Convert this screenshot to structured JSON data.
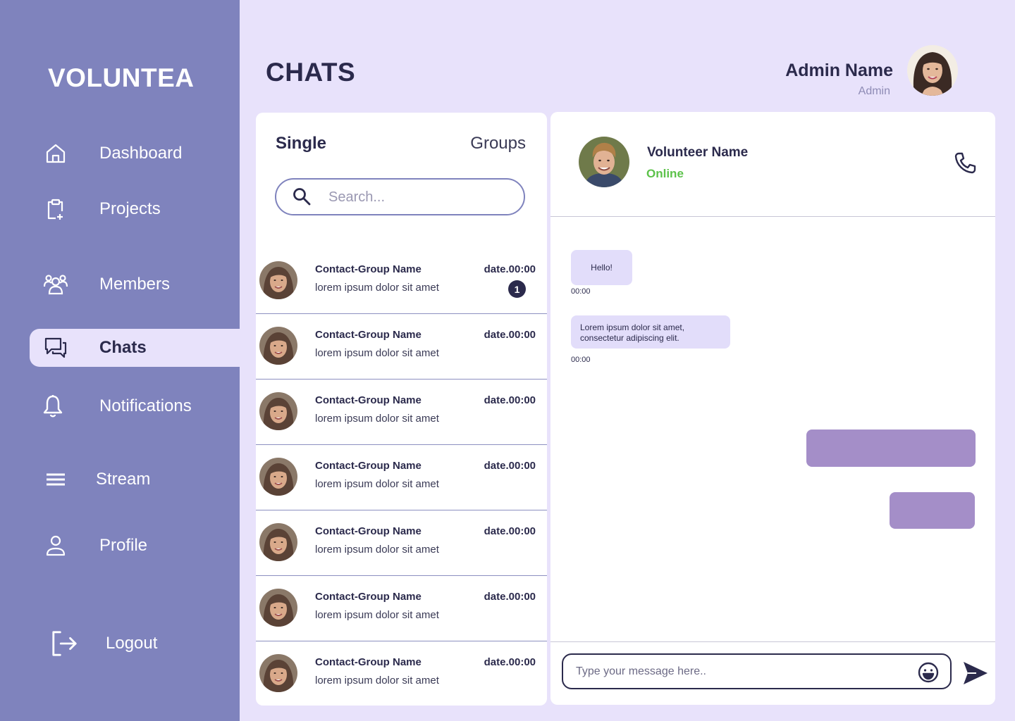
{
  "app": {
    "logo": "VOLUNTEA"
  },
  "sidebar": {
    "items": [
      {
        "label": "Dashboard",
        "icon": "home-icon"
      },
      {
        "label": "Projects",
        "icon": "clipboard-plus-icon"
      },
      {
        "label": "Members",
        "icon": "users-icon"
      },
      {
        "label": "Chats",
        "icon": "chat-icon",
        "active": true
      },
      {
        "label": "Notifications",
        "icon": "bell-icon"
      },
      {
        "label": "Stream",
        "icon": "menu-icon"
      },
      {
        "label": "Profile",
        "icon": "user-icon"
      },
      {
        "label": "Logout",
        "icon": "logout-icon"
      }
    ]
  },
  "header": {
    "title": "CHATS",
    "admin_name": "Admin Name",
    "admin_role": "Admin"
  },
  "contacts_panel": {
    "tabs": {
      "single": "Single",
      "groups": "Groups"
    },
    "search_placeholder": "Search...",
    "contacts": [
      {
        "name": "Contact-Group Name",
        "message": "lorem ipsum dolor sit amet",
        "date": "date.00:00",
        "unread": "1"
      },
      {
        "name": "Contact-Group Name",
        "message": "lorem ipsum dolor sit amet",
        "date": "date.00:00"
      },
      {
        "name": "Contact-Group Name",
        "message": "lorem ipsum dolor sit amet",
        "date": "date.00:00"
      },
      {
        "name": "Contact-Group Name",
        "message": "lorem ipsum dolor sit amet",
        "date": "date.00:00"
      },
      {
        "name": "Contact-Group Name",
        "message": "lorem ipsum dolor sit amet",
        "date": "date.00:00"
      },
      {
        "name": "Contact-Group Name",
        "message": "lorem ipsum dolor sit amet",
        "date": "date.00:00"
      },
      {
        "name": "Contact-Group Name",
        "message": "lorem ipsum dolor sit amet",
        "date": "date.00:00"
      }
    ]
  },
  "chat": {
    "volunteer_name": "Volunteer Name",
    "status": "Online",
    "messages": [
      {
        "text": "Hello!",
        "time": "00:00"
      },
      {
        "text": "Lorem ipsum dolor sit amet, consectetur adipiscing elit.",
        "time": "00:00"
      }
    ],
    "composer_placeholder": "Type your message here.."
  },
  "colors": {
    "sidebar": "#7f83bd",
    "background": "#e8e2fb",
    "text_dark": "#2b2a4c",
    "online": "#5cc24a",
    "bubble_in": "#e2ddfa",
    "bubble_out": "#a48ec8"
  }
}
